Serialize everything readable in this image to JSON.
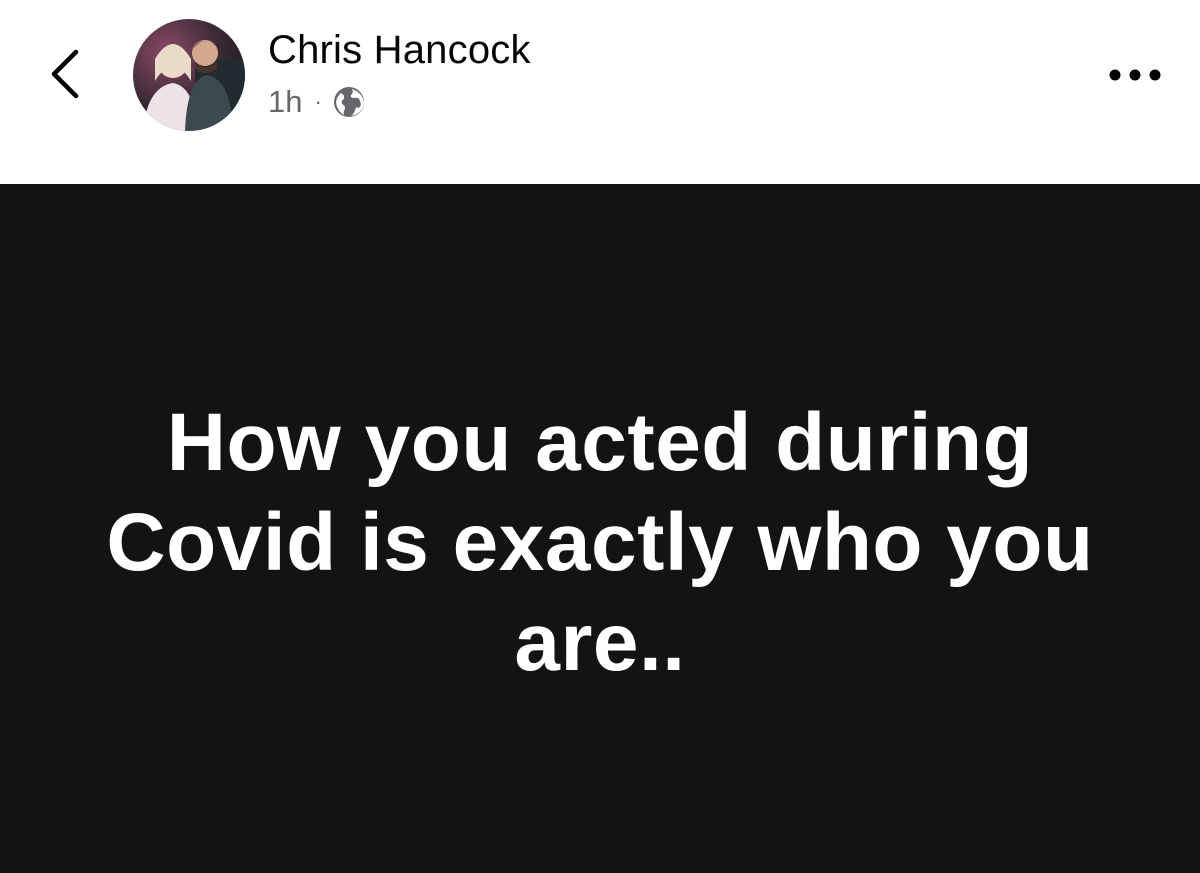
{
  "post": {
    "author": "Chris Hancock",
    "timestamp": "1h",
    "separator": "·",
    "audience_icon": "globe-icon",
    "text": "How you acted during Covid is exactly who you are.."
  },
  "header": {
    "back_icon": "chevron-left-icon",
    "more_icon": "more-horizontal-icon"
  },
  "colors": {
    "background": "#ffffff",
    "post_background": "#131313",
    "post_text": "#ffffff",
    "name_text": "#050505",
    "meta_text": "#65676b"
  }
}
